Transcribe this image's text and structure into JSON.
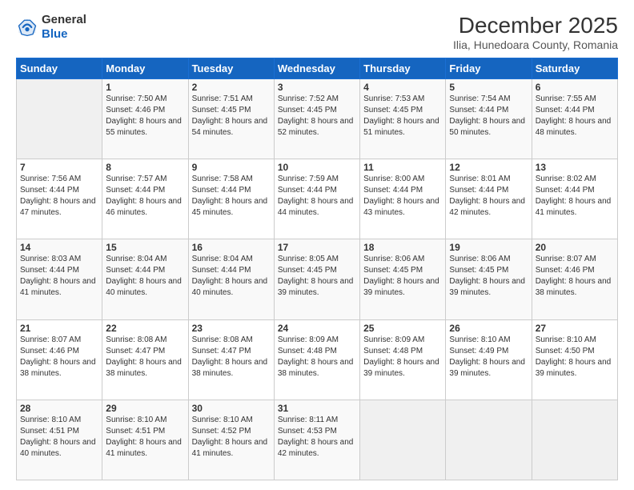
{
  "header": {
    "logo_line1": "General",
    "logo_line2": "Blue",
    "month_title": "December 2025",
    "subtitle": "Ilia, Hunedoara County, Romania"
  },
  "weekdays": [
    "Sunday",
    "Monday",
    "Tuesday",
    "Wednesday",
    "Thursday",
    "Friday",
    "Saturday"
  ],
  "weeks": [
    [
      {
        "day": "",
        "sunrise": "",
        "sunset": "",
        "daylight": ""
      },
      {
        "day": "1",
        "sunrise": "Sunrise: 7:50 AM",
        "sunset": "Sunset: 4:46 PM",
        "daylight": "Daylight: 8 hours and 55 minutes."
      },
      {
        "day": "2",
        "sunrise": "Sunrise: 7:51 AM",
        "sunset": "Sunset: 4:45 PM",
        "daylight": "Daylight: 8 hours and 54 minutes."
      },
      {
        "day": "3",
        "sunrise": "Sunrise: 7:52 AM",
        "sunset": "Sunset: 4:45 PM",
        "daylight": "Daylight: 8 hours and 52 minutes."
      },
      {
        "day": "4",
        "sunrise": "Sunrise: 7:53 AM",
        "sunset": "Sunset: 4:45 PM",
        "daylight": "Daylight: 8 hours and 51 minutes."
      },
      {
        "day": "5",
        "sunrise": "Sunrise: 7:54 AM",
        "sunset": "Sunset: 4:44 PM",
        "daylight": "Daylight: 8 hours and 50 minutes."
      },
      {
        "day": "6",
        "sunrise": "Sunrise: 7:55 AM",
        "sunset": "Sunset: 4:44 PM",
        "daylight": "Daylight: 8 hours and 48 minutes."
      }
    ],
    [
      {
        "day": "7",
        "sunrise": "Sunrise: 7:56 AM",
        "sunset": "Sunset: 4:44 PM",
        "daylight": "Daylight: 8 hours and 47 minutes."
      },
      {
        "day": "8",
        "sunrise": "Sunrise: 7:57 AM",
        "sunset": "Sunset: 4:44 PM",
        "daylight": "Daylight: 8 hours and 46 minutes."
      },
      {
        "day": "9",
        "sunrise": "Sunrise: 7:58 AM",
        "sunset": "Sunset: 4:44 PM",
        "daylight": "Daylight: 8 hours and 45 minutes."
      },
      {
        "day": "10",
        "sunrise": "Sunrise: 7:59 AM",
        "sunset": "Sunset: 4:44 PM",
        "daylight": "Daylight: 8 hours and 44 minutes."
      },
      {
        "day": "11",
        "sunrise": "Sunrise: 8:00 AM",
        "sunset": "Sunset: 4:44 PM",
        "daylight": "Daylight: 8 hours and 43 minutes."
      },
      {
        "day": "12",
        "sunrise": "Sunrise: 8:01 AM",
        "sunset": "Sunset: 4:44 PM",
        "daylight": "Daylight: 8 hours and 42 minutes."
      },
      {
        "day": "13",
        "sunrise": "Sunrise: 8:02 AM",
        "sunset": "Sunset: 4:44 PM",
        "daylight": "Daylight: 8 hours and 41 minutes."
      }
    ],
    [
      {
        "day": "14",
        "sunrise": "Sunrise: 8:03 AM",
        "sunset": "Sunset: 4:44 PM",
        "daylight": "Daylight: 8 hours and 41 minutes."
      },
      {
        "day": "15",
        "sunrise": "Sunrise: 8:04 AM",
        "sunset": "Sunset: 4:44 PM",
        "daylight": "Daylight: 8 hours and 40 minutes."
      },
      {
        "day": "16",
        "sunrise": "Sunrise: 8:04 AM",
        "sunset": "Sunset: 4:44 PM",
        "daylight": "Daylight: 8 hours and 40 minutes."
      },
      {
        "day": "17",
        "sunrise": "Sunrise: 8:05 AM",
        "sunset": "Sunset: 4:45 PM",
        "daylight": "Daylight: 8 hours and 39 minutes."
      },
      {
        "day": "18",
        "sunrise": "Sunrise: 8:06 AM",
        "sunset": "Sunset: 4:45 PM",
        "daylight": "Daylight: 8 hours and 39 minutes."
      },
      {
        "day": "19",
        "sunrise": "Sunrise: 8:06 AM",
        "sunset": "Sunset: 4:45 PM",
        "daylight": "Daylight: 8 hours and 39 minutes."
      },
      {
        "day": "20",
        "sunrise": "Sunrise: 8:07 AM",
        "sunset": "Sunset: 4:46 PM",
        "daylight": "Daylight: 8 hours and 38 minutes."
      }
    ],
    [
      {
        "day": "21",
        "sunrise": "Sunrise: 8:07 AM",
        "sunset": "Sunset: 4:46 PM",
        "daylight": "Daylight: 8 hours and 38 minutes."
      },
      {
        "day": "22",
        "sunrise": "Sunrise: 8:08 AM",
        "sunset": "Sunset: 4:47 PM",
        "daylight": "Daylight: 8 hours and 38 minutes."
      },
      {
        "day": "23",
        "sunrise": "Sunrise: 8:08 AM",
        "sunset": "Sunset: 4:47 PM",
        "daylight": "Daylight: 8 hours and 38 minutes."
      },
      {
        "day": "24",
        "sunrise": "Sunrise: 8:09 AM",
        "sunset": "Sunset: 4:48 PM",
        "daylight": "Daylight: 8 hours and 38 minutes."
      },
      {
        "day": "25",
        "sunrise": "Sunrise: 8:09 AM",
        "sunset": "Sunset: 4:48 PM",
        "daylight": "Daylight: 8 hours and 39 minutes."
      },
      {
        "day": "26",
        "sunrise": "Sunrise: 8:10 AM",
        "sunset": "Sunset: 4:49 PM",
        "daylight": "Daylight: 8 hours and 39 minutes."
      },
      {
        "day": "27",
        "sunrise": "Sunrise: 8:10 AM",
        "sunset": "Sunset: 4:50 PM",
        "daylight": "Daylight: 8 hours and 39 minutes."
      }
    ],
    [
      {
        "day": "28",
        "sunrise": "Sunrise: 8:10 AM",
        "sunset": "Sunset: 4:51 PM",
        "daylight": "Daylight: 8 hours and 40 minutes."
      },
      {
        "day": "29",
        "sunrise": "Sunrise: 8:10 AM",
        "sunset": "Sunset: 4:51 PM",
        "daylight": "Daylight: 8 hours and 41 minutes."
      },
      {
        "day": "30",
        "sunrise": "Sunrise: 8:10 AM",
        "sunset": "Sunset: 4:52 PM",
        "daylight": "Daylight: 8 hours and 41 minutes."
      },
      {
        "day": "31",
        "sunrise": "Sunrise: 8:11 AM",
        "sunset": "Sunset: 4:53 PM",
        "daylight": "Daylight: 8 hours and 42 minutes."
      },
      {
        "day": "",
        "sunrise": "",
        "sunset": "",
        "daylight": ""
      },
      {
        "day": "",
        "sunrise": "",
        "sunset": "",
        "daylight": ""
      },
      {
        "day": "",
        "sunrise": "",
        "sunset": "",
        "daylight": ""
      }
    ]
  ]
}
